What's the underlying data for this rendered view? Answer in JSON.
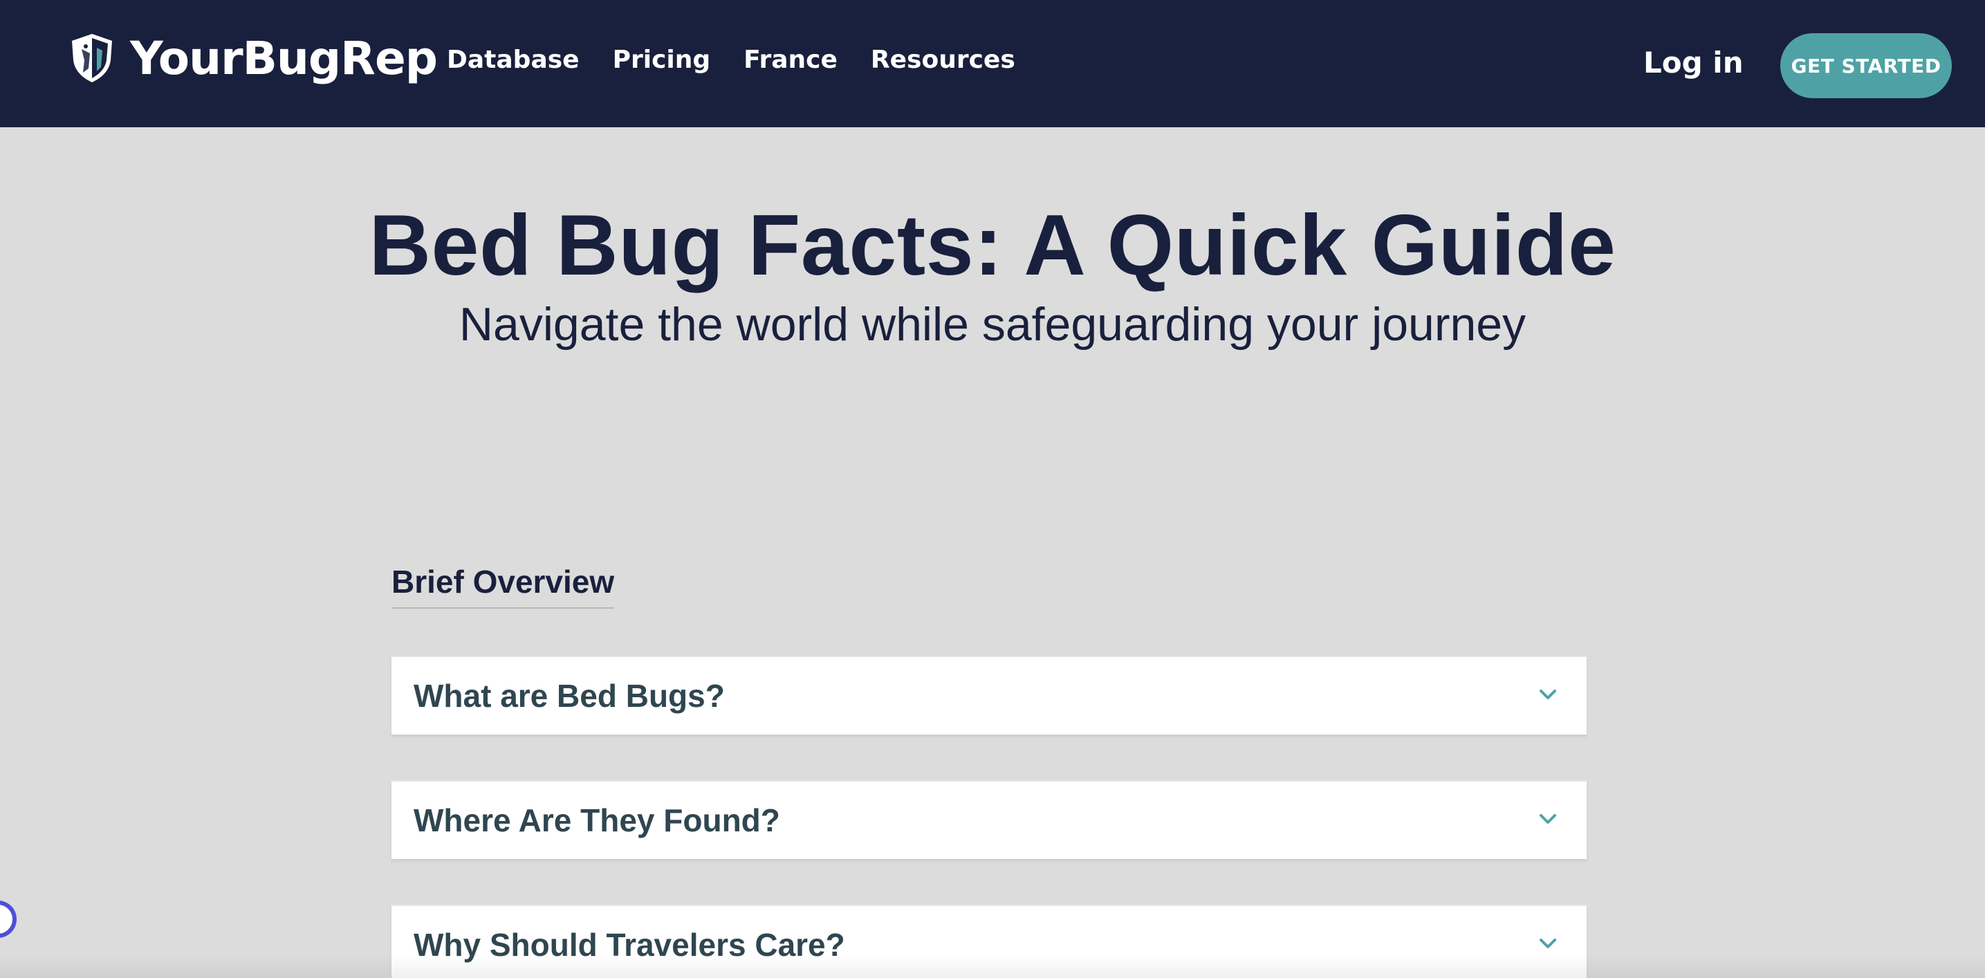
{
  "brand": {
    "name": "YourBugRep",
    "logo_icon": "shield-bug-logo-icon"
  },
  "nav": {
    "links": [
      {
        "label": "Database"
      },
      {
        "label": "Pricing"
      },
      {
        "label": "France"
      },
      {
        "label": "Resources"
      }
    ],
    "login_label": "Log in",
    "cta_label": "GET STARTED"
  },
  "hero": {
    "title": "Bed Bug Facts: A Quick Guide",
    "subtitle": "Navigate the world while safeguarding your journey"
  },
  "overview": {
    "heading": "Brief Overview",
    "items": [
      {
        "question": "What are Bed Bugs?",
        "icon": "chevron-down-icon"
      },
      {
        "question": "Where Are They Found?",
        "icon": "chevron-down-icon"
      },
      {
        "question": "Why Should Travelers Care?",
        "icon": "chevron-down-icon"
      }
    ]
  },
  "colors": {
    "navbar": "#19203d",
    "accent": "#4ea2a6",
    "page_background": "#dcdcdc",
    "accordion_text": "#2f4650",
    "widget_ring": "#4d4fd8"
  }
}
